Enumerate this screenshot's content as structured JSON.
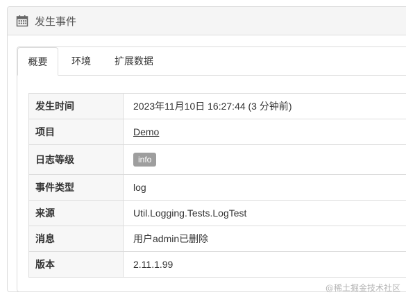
{
  "panel": {
    "title": "发生事件",
    "icon": "calendar-icon"
  },
  "tabs": [
    {
      "label": "概要",
      "active": true
    },
    {
      "label": "环境",
      "active": false
    },
    {
      "label": "扩展数据",
      "active": false
    }
  ],
  "rows": [
    {
      "label": "发生时间",
      "value": "2023年11月10日 16:27:44 (3 分钟前)",
      "kind": "text"
    },
    {
      "label": "项目",
      "value": "Demo",
      "kind": "link"
    },
    {
      "label": "日志等级",
      "value": "info",
      "kind": "badge"
    },
    {
      "label": "事件类型",
      "value": "log",
      "kind": "text"
    },
    {
      "label": "来源",
      "value": "Util.Logging.Tests.LogTest",
      "kind": "text"
    },
    {
      "label": "消息",
      "value": "用户admin已删除",
      "kind": "text"
    },
    {
      "label": "版本",
      "value": "2.11.1.99",
      "kind": "text"
    }
  ],
  "watermark": "@稀土掘金技术社区",
  "colors": {
    "badge": "#9e9e9e",
    "header_bg": "#f5f5f5",
    "label_bg": "#f7f7f7",
    "border": "#dcdcdc"
  }
}
